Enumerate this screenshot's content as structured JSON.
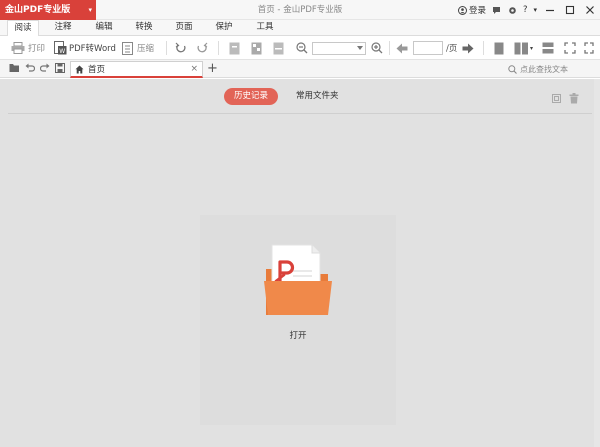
{
  "app": {
    "badge": "金山PDF专业版",
    "badge_caret": "▾",
    "window_title": "首页 - 金山PDF专业版"
  },
  "title_right": {
    "login": "登录",
    "help": "?",
    "more": "▾",
    "minimize_icon": "minimize-icon",
    "maximize_icon": "maximize-icon",
    "close_icon": "close-icon"
  },
  "menu": {
    "tabs": [
      {
        "label": "阅读",
        "active": true
      },
      {
        "label": "注释"
      },
      {
        "label": "编辑"
      },
      {
        "label": "转换"
      },
      {
        "label": "页面"
      },
      {
        "label": "保护"
      },
      {
        "label": "工具"
      }
    ]
  },
  "toolbar": {
    "print": "打印",
    "pdf_to_word": "PDF转Word",
    "compress": "压缩",
    "page_suffix": "/页",
    "zoom_value": "",
    "page_value": ""
  },
  "tabs": {
    "doc_tab": "首页",
    "close": "×",
    "new_tab": "+",
    "search_placeholder": "点此查找文本"
  },
  "home": {
    "history": "历史记录",
    "common_folders": "常用文件夹",
    "open": "打开"
  },
  "colors": {
    "accent": "#d9413a",
    "pill": "#e26457",
    "folder": "#f0894a",
    "background": "#e1e1e1"
  }
}
